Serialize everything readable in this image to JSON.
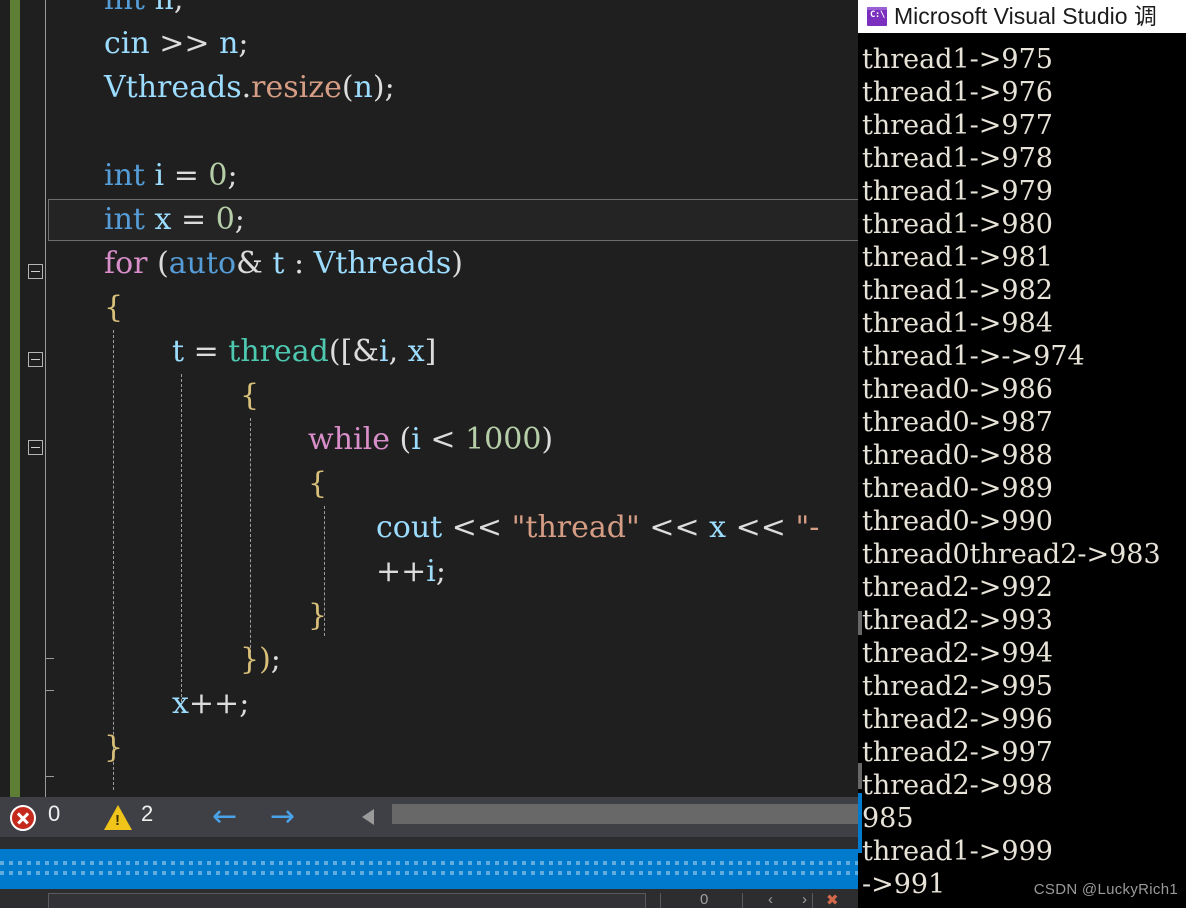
{
  "editor": {
    "code_lines": [
      {
        "indent": 0,
        "tokens": [
          {
            "t": "kw",
            "s": "int"
          },
          {
            "t": "plain",
            "s": " "
          },
          {
            "t": "id",
            "s": "n"
          },
          {
            "t": "punc",
            "s": ";"
          }
        ]
      },
      {
        "indent": 0,
        "tokens": [
          {
            "t": "id",
            "s": "cin"
          },
          {
            "t": "plain",
            "s": " "
          },
          {
            "t": "punc",
            "s": ">>"
          },
          {
            "t": "plain",
            "s": " "
          },
          {
            "t": "id",
            "s": "n"
          },
          {
            "t": "punc",
            "s": ";"
          }
        ]
      },
      {
        "indent": 0,
        "tokens": [
          {
            "t": "id",
            "s": "Vthreads"
          },
          {
            "t": "punc",
            "s": "."
          },
          {
            "t": "str",
            "s": "resize"
          },
          {
            "t": "punc",
            "s": "("
          },
          {
            "t": "id",
            "s": "n"
          },
          {
            "t": "punc",
            "s": ");"
          }
        ]
      },
      {
        "indent": 0,
        "tokens": []
      },
      {
        "indent": 0,
        "tokens": [
          {
            "t": "kw",
            "s": "int"
          },
          {
            "t": "plain",
            "s": " "
          },
          {
            "t": "id",
            "s": "i"
          },
          {
            "t": "plain",
            "s": " "
          },
          {
            "t": "punc",
            "s": "="
          },
          {
            "t": "plain",
            "s": " "
          },
          {
            "t": "num",
            "s": "0"
          },
          {
            "t": "punc",
            "s": ";"
          }
        ]
      },
      {
        "indent": 0,
        "tokens": [
          {
            "t": "kw",
            "s": "int"
          },
          {
            "t": "plain",
            "s": " "
          },
          {
            "t": "id",
            "s": "x"
          },
          {
            "t": "plain",
            "s": " "
          },
          {
            "t": "punc",
            "s": "="
          },
          {
            "t": "plain",
            "s": " "
          },
          {
            "t": "num",
            "s": "0"
          },
          {
            "t": "punc",
            "s": ";"
          }
        ]
      },
      {
        "indent": 0,
        "tokens": [
          {
            "t": "ctrl",
            "s": "for"
          },
          {
            "t": "plain",
            "s": " "
          },
          {
            "t": "punc",
            "s": "("
          },
          {
            "t": "kw",
            "s": "auto"
          },
          {
            "t": "punc",
            "s": "&"
          },
          {
            "t": "plain",
            "s": " "
          },
          {
            "t": "id",
            "s": "t"
          },
          {
            "t": "plain",
            "s": " "
          },
          {
            "t": "punc",
            "s": ":"
          },
          {
            "t": "plain",
            "s": " "
          },
          {
            "t": "id",
            "s": "Vthreads"
          },
          {
            "t": "punc",
            "s": ")"
          }
        ]
      },
      {
        "indent": 0,
        "tokens": [
          {
            "t": "brace",
            "s": "{"
          }
        ]
      },
      {
        "indent": 1,
        "tokens": [
          {
            "t": "id",
            "s": "t"
          },
          {
            "t": "plain",
            "s": " "
          },
          {
            "t": "punc",
            "s": "="
          },
          {
            "t": "plain",
            "s": " "
          },
          {
            "t": "type",
            "s": "thread"
          },
          {
            "t": "punc",
            "s": "(["
          },
          {
            "t": "punc",
            "s": "&"
          },
          {
            "t": "id",
            "s": "i"
          },
          {
            "t": "punc",
            "s": ","
          },
          {
            "t": "plain",
            "s": " "
          },
          {
            "t": "id",
            "s": "x"
          },
          {
            "t": "punc",
            "s": "]"
          }
        ]
      },
      {
        "indent": 2,
        "tokens": [
          {
            "t": "brace",
            "s": "{"
          }
        ]
      },
      {
        "indent": 3,
        "tokens": [
          {
            "t": "ctrl",
            "s": "while"
          },
          {
            "t": "plain",
            "s": " "
          },
          {
            "t": "punc",
            "s": "("
          },
          {
            "t": "id",
            "s": "i"
          },
          {
            "t": "plain",
            "s": " "
          },
          {
            "t": "punc",
            "s": "<"
          },
          {
            "t": "plain",
            "s": " "
          },
          {
            "t": "num",
            "s": "1000"
          },
          {
            "t": "punc",
            "s": ")"
          }
        ]
      },
      {
        "indent": 3,
        "tokens": [
          {
            "t": "brace",
            "s": "{"
          }
        ]
      },
      {
        "indent": 4,
        "tokens": [
          {
            "t": "id",
            "s": "cout"
          },
          {
            "t": "plain",
            "s": " "
          },
          {
            "t": "punc",
            "s": "<<"
          },
          {
            "t": "plain",
            "s": " "
          },
          {
            "t": "str",
            "s": "\"thread\""
          },
          {
            "t": "plain",
            "s": " "
          },
          {
            "t": "punc",
            "s": "<<"
          },
          {
            "t": "plain",
            "s": " "
          },
          {
            "t": "id",
            "s": "x"
          },
          {
            "t": "plain",
            "s": " "
          },
          {
            "t": "punc",
            "s": "<<"
          },
          {
            "t": "plain",
            "s": " "
          },
          {
            "t": "str",
            "s": "\"-"
          }
        ]
      },
      {
        "indent": 4,
        "tokens": [
          {
            "t": "punc",
            "s": "++"
          },
          {
            "t": "id",
            "s": "i"
          },
          {
            "t": "punc",
            "s": ";"
          }
        ]
      },
      {
        "indent": 3,
        "tokens": [
          {
            "t": "brace",
            "s": "}"
          }
        ]
      },
      {
        "indent": 2,
        "tokens": [
          {
            "t": "brace",
            "s": "})"
          },
          {
            "t": "punc",
            "s": ";"
          }
        ]
      },
      {
        "indent": 1,
        "tokens": [
          {
            "t": "id",
            "s": "x"
          },
          {
            "t": "punc",
            "s": "++;"
          }
        ]
      },
      {
        "indent": 0,
        "tokens": [
          {
            "t": "brace",
            "s": "}"
          }
        ]
      }
    ],
    "status": {
      "error_count": "0",
      "warning_count": "2",
      "prev_arrow": "←",
      "next_arrow": "→"
    },
    "find_bar": {
      "value": "",
      "count_label": "0",
      "prev_label": "‹",
      "next_label": "›",
      "close_label": "✖"
    }
  },
  "console": {
    "title": "Microsoft Visual Studio 调",
    "icon": "console-app-icon",
    "icon_glyph": "C:\\",
    "lines": [
      "thread1->975",
      "thread1->976",
      "thread1->977",
      "thread1->978",
      "thread1->979",
      "thread1->980",
      "thread1->981",
      "thread1->982",
      "thread1->984",
      "thread1->->974",
      "thread0->986",
      "thread0->987",
      "thread0->988",
      "thread0->989",
      "thread0->990",
      "thread0thread2->983",
      "thread2->992",
      "thread2->993",
      "thread2->994",
      "thread2->995",
      "thread2->996",
      "thread2->997",
      "thread2->998",
      "985",
      "thread1->999",
      "->991"
    ]
  },
  "watermark": {
    "text": "CSDN @LuckyRich1"
  },
  "colors": {
    "editor_bg": "#1f1f1f",
    "track_green": "#5d7e34",
    "status_blue": "#007acc",
    "statusbar_gray": "#3f3f46",
    "console_bg": "#000000",
    "console_text": "#e8e3d8",
    "error_red": "#c42b1c",
    "warning_yellow": "#f0c419",
    "arrow_blue": "#4aa3e8"
  }
}
